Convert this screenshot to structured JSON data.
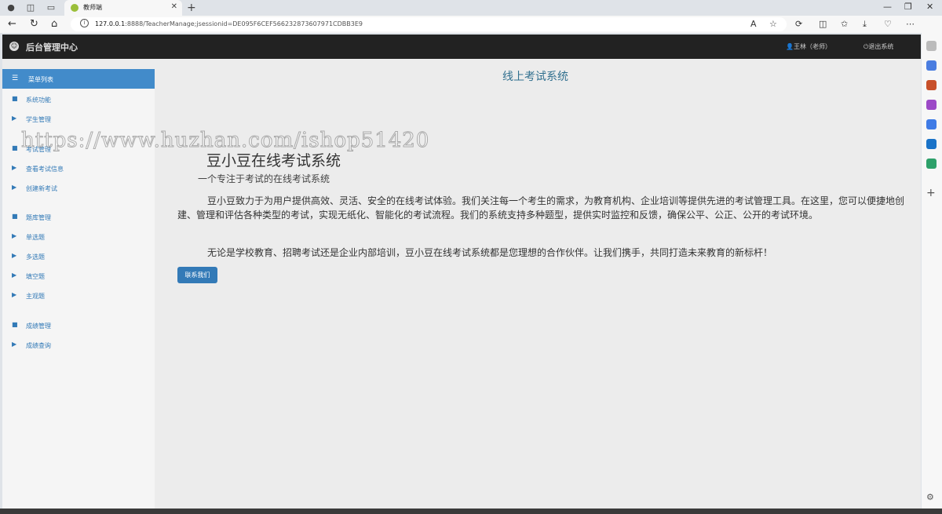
{
  "browser": {
    "tab_title": "教师端",
    "tab_close": "✕",
    "new_tab": "+",
    "url_host": "127.0.0.1",
    "url_rest": ":8888/TeacherManage;jsessionid=DE095F6CEF566232873607971CDBB3E9"
  },
  "app": {
    "brand": "后台管理中心",
    "user": "王林（老师）",
    "logout": "退出系统",
    "site_title": "线上考试系统"
  },
  "sidebar": {
    "header": "菜单列表",
    "items": [
      {
        "label": "系统功能",
        "icon": "briefcase-icon"
      },
      {
        "label": "学生管理",
        "icon": "play-icon"
      },
      {
        "label": "考试管理",
        "icon": "briefcase-icon"
      },
      {
        "label": "查看考试信息",
        "icon": "play-icon"
      },
      {
        "label": "创建新考试",
        "icon": "play-icon"
      },
      {
        "label": "题库管理",
        "icon": "briefcase-icon"
      },
      {
        "label": "单选题",
        "icon": "play-icon"
      },
      {
        "label": "多选题",
        "icon": "play-icon"
      },
      {
        "label": "填空题",
        "icon": "play-icon"
      },
      {
        "label": "主观题",
        "icon": "play-icon"
      },
      {
        "label": "成绩管理",
        "icon": "briefcase-icon"
      },
      {
        "label": "成绩查询",
        "icon": "play-icon"
      }
    ]
  },
  "hero": {
    "title": "豆小豆在线考试系统",
    "subtitle": "一个专注于考试的在线考试系统",
    "paragraph1": "豆小豆致力于为用户提供高效、灵活、安全的在线考试体验。我们关注每一个考生的需求，为教育机构、企业培训等提供先进的考试管理工具。在这里，您可以便捷地创建、管理和评估各种类型的考试，实现无纸化、智能化的考试流程。我们的系统支持多种题型，提供实时监控和反馈，确保公平、公正、公开的考试环境。",
    "paragraph2": "无论是学校教育、招聘考试还是企业内部培训，豆小豆在线考试系统都是您理想的合作伙伴。让我们携手，共同打造未来教育的新标杆！",
    "contact_button": "联系我们"
  },
  "watermark": "https://www.huzhan.com/ishop51420",
  "colors": {
    "primary": "#337ab7",
    "menu_header": "#428bca",
    "navbar": "#222222",
    "site_title": "#31708f"
  }
}
